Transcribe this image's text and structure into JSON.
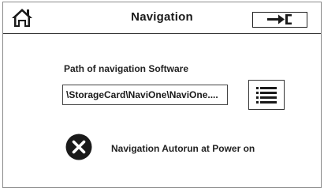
{
  "header": {
    "title": "Navigation",
    "home_icon": "home-icon",
    "exit_icon": "exit-arrow-icon"
  },
  "path_section": {
    "label": "Path of navigation Software",
    "value": "\\StorageCard\\NaviOne\\NaviOne....",
    "browse_icon": "list-icon"
  },
  "autorun": {
    "label": "Navigation Autorun at Power on",
    "state": "off",
    "icon": "close-circle-icon"
  },
  "colors": {
    "foreground": "#1a1a1a",
    "background": "#ffffff",
    "border": "#333333"
  }
}
